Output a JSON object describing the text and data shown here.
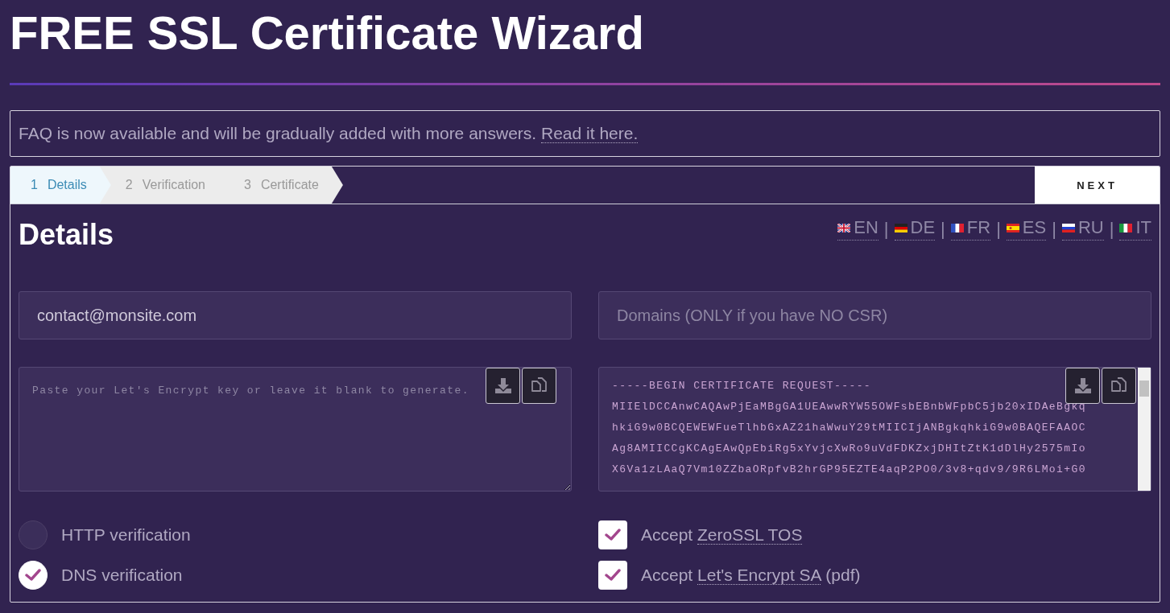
{
  "title": "FREE SSL Certificate Wizard",
  "notice": {
    "text": "FAQ is now available and will be gradually added with more answers.",
    "link": "Read it here."
  },
  "steps": [
    {
      "number": "1",
      "label": "Details",
      "selected": true
    },
    {
      "number": "2",
      "label": "Verification",
      "selected": false
    },
    {
      "number": "3",
      "label": "Certificate",
      "selected": false
    }
  ],
  "next_button": "NEXT",
  "section_title": "Details",
  "languages": [
    {
      "code": "EN",
      "kind": "gb"
    },
    {
      "code": "DE",
      "kind": "de"
    },
    {
      "code": "FR",
      "kind": "fr"
    },
    {
      "code": "ES",
      "kind": "es"
    },
    {
      "code": "RU",
      "kind": "ru"
    },
    {
      "code": "IT",
      "kind": "it"
    }
  ],
  "language_separator": "|",
  "email_field": {
    "value": "contact@monsite.com"
  },
  "domains_field": {
    "placeholder": "Domains (ONLY if you have NO CSR)"
  },
  "key_field": {
    "placeholder": "Paste your Let's Encrypt key or leave it blank to generate."
  },
  "csr_field": {
    "lines": [
      "-----BEGIN CERTIFICATE REQUEST-----",
      "MIIElDCCAnwCAQAwPjEaMBgGA1UEAwwRYW55OWFsbEBnbWFpbC5jb20xIDAeBgkq",
      "hkiG9w0BCQEWEWFueTlhbGxAZ21haWwuY29tMIICIjANBgkqhkiG9w0BAQEFAAOC",
      "Ag8AMIICCgKCAgEAwQpEbiRg5xYvjcXwRo9uVdFDKZxjDHItZtK1dDlHy2575mIo",
      "X6Va1zLAaQ7Vm10ZZbaORpfvB2hrGP95EZTE4aqP2PO0/3v8+qdv9/9R6LMoi+G0"
    ]
  },
  "verification": [
    {
      "label": "HTTP verification",
      "selected": false
    },
    {
      "label": "DNS verification",
      "selected": true
    }
  ],
  "agreements": [
    {
      "prefix": "Accept",
      "link": "ZeroSSL TOS",
      "checked": true
    },
    {
      "prefix": "Accept",
      "link": "Let's Encrypt SA",
      "suffix": "(pdf)",
      "checked": true
    }
  ]
}
